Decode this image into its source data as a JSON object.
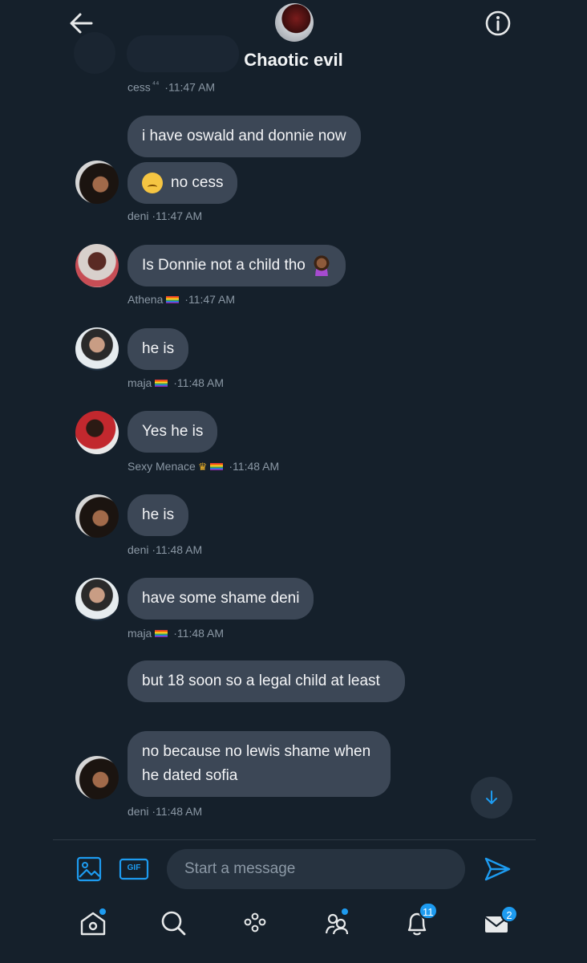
{
  "header": {
    "title": "Chaotic evil",
    "back_icon": "arrow-left-icon",
    "info_icon": "info-icon"
  },
  "messages": [
    {
      "meta_name": "cess",
      "meta_suffix": "⁴⁴",
      "meta_time": "11:47 AM"
    },
    {
      "sender": "deni",
      "texts": [
        "i have oswald and donnie now",
        "no cess"
      ],
      "emoji": "pensive-face-icon",
      "meta_name": "deni",
      "meta_time": "11:47 AM"
    },
    {
      "sender": "Athena",
      "texts": [
        "Is Donnie not a child tho"
      ],
      "emoji": "person-tipping-hand-icon",
      "meta_name": "Athena",
      "meta_time": "11:47 AM"
    },
    {
      "sender": "maja",
      "texts": [
        "he is"
      ],
      "meta_name": "maja",
      "meta_time": "11:48 AM"
    },
    {
      "sender": "Sexy Menace",
      "texts": [
        "Yes he is"
      ],
      "meta_name": "Sexy Menace",
      "meta_time": "11:48 AM"
    },
    {
      "sender": "deni",
      "texts": [
        "he is"
      ],
      "meta_name": "deni",
      "meta_time": "11:48 AM"
    },
    {
      "sender": "maja",
      "texts": [
        "have some shame deni"
      ],
      "meta_name": "maja",
      "meta_time": "11:48 AM"
    },
    {
      "sender": "deni",
      "texts": [
        "but 18 soon so a legal child at least",
        "no because no lewis shame when he dated sofia"
      ],
      "meta_name": "deni",
      "meta_time": "11:48 AM"
    }
  ],
  "separator": "·",
  "composer": {
    "placeholder": "Start a message",
    "gif_label": "GIF",
    "media_icon": "image-icon",
    "send_icon": "send-icon"
  },
  "scroll_down_icon": "arrow-down-icon",
  "nav": {
    "items": [
      "home-icon",
      "search-icon",
      "spaces-icon",
      "communities-icon",
      "notifications-icon",
      "messages-icon"
    ],
    "notifications_badge": "11",
    "messages_badge": "2"
  },
  "colors": {
    "background": "#15202b",
    "bubble": "#3c4756",
    "accent": "#1d9bf0"
  }
}
